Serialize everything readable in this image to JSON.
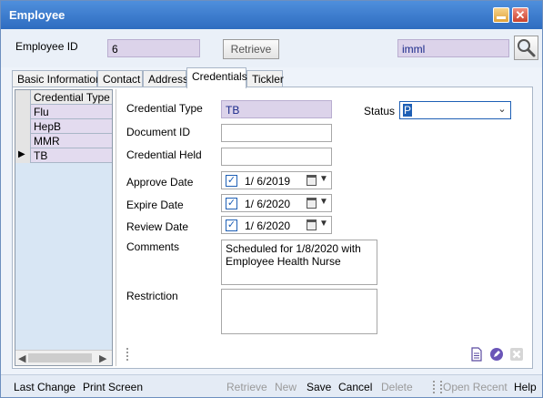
{
  "window": {
    "title": "Employee"
  },
  "top": {
    "employee_id_label": "Employee ID",
    "employee_id_value": "6",
    "retrieve_label": "Retrieve",
    "user_value": "imml"
  },
  "tabs": [
    {
      "label": "Basic Information"
    },
    {
      "label": "Contact"
    },
    {
      "label": "Address"
    },
    {
      "label": "Credentials",
      "active": true
    },
    {
      "label": "Tickler"
    }
  ],
  "grid": {
    "header": "Credential Type",
    "rows": [
      "Flu",
      "HepB",
      "MMR",
      "TB"
    ],
    "current_marker": "▶"
  },
  "form": {
    "credential_type_label": "Credential Type",
    "credential_type_value": "TB",
    "status_label": "Status",
    "status_value": "P",
    "document_id_label": "Document ID",
    "document_id_value": "",
    "credential_held_label": "Credential Held",
    "credential_held_value": "",
    "approve_date_label": "Approve Date",
    "approve_date_value": "1/  6/2019",
    "expire_date_label": "Expire Date",
    "expire_date_value": "1/  6/2020",
    "review_date_label": "Review Date",
    "review_date_value": "1/  6/2020",
    "comments_label": "Comments",
    "comments_value": "Scheduled for 1/8/2020 with Employee Health Nurse",
    "restriction_label": "Restriction",
    "restriction_value": ""
  },
  "statusbar": {
    "last_change": "Last Change",
    "print_screen": "Print Screen",
    "retrieve": "Retrieve",
    "new": "New",
    "save": "Save",
    "cancel": "Cancel",
    "delete": "Delete",
    "open_recent": "Open Recent",
    "help": "Help"
  },
  "colors": {
    "titlebar": "#3a7bd0",
    "accent_lavender": "#dcd3ea",
    "selection": "#1e5fb5"
  }
}
